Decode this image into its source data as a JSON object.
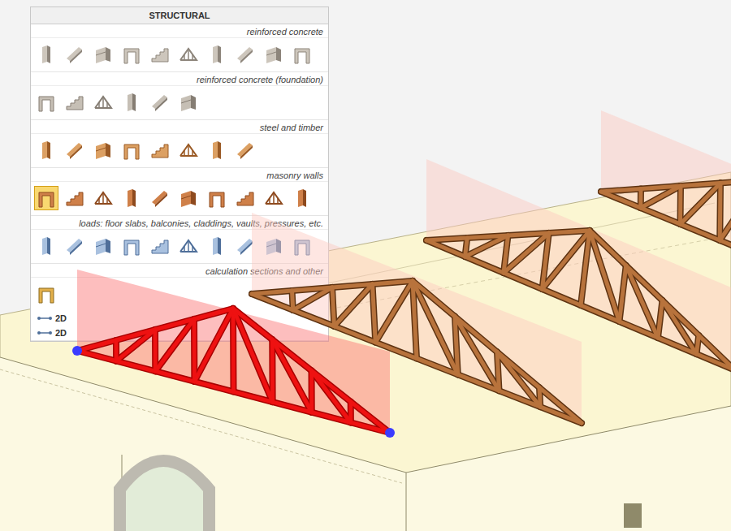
{
  "panel": {
    "title": "STRUCTURAL",
    "sections": [
      {
        "title": "reinforced concrete",
        "icons": [
          {
            "selected": false
          },
          {
            "selected": false
          },
          {
            "selected": false
          },
          {
            "selected": false
          },
          {
            "selected": false
          },
          {
            "selected": false
          },
          {
            "selected": false
          },
          {
            "selected": false
          },
          {
            "selected": false
          },
          {
            "selected": false
          }
        ]
      },
      {
        "title": "reinforced concrete (foundation)",
        "icons": [
          {
            "selected": false
          },
          {
            "selected": false
          },
          {
            "selected": false
          },
          {
            "selected": false
          },
          {
            "selected": false
          },
          {
            "selected": false
          }
        ]
      },
      {
        "title": "steel and timber",
        "icons": [
          {
            "selected": false
          },
          {
            "selected": false
          },
          {
            "selected": false
          },
          {
            "selected": false
          },
          {
            "selected": false
          },
          {
            "selected": false
          },
          {
            "selected": false
          },
          {
            "selected": false
          }
        ]
      },
      {
        "title": "masonry walls",
        "icons": [
          {
            "selected": true
          },
          {
            "selected": false
          },
          {
            "selected": false
          },
          {
            "selected": false
          },
          {
            "selected": false
          },
          {
            "selected": false
          },
          {
            "selected": false
          },
          {
            "selected": false
          },
          {
            "selected": false
          },
          {
            "selected": false
          }
        ]
      },
      {
        "title": "loads: floor slabs, balconies, claddings, vaults, pressures, etc.",
        "icons": [
          {
            "selected": false
          },
          {
            "selected": false
          },
          {
            "selected": false
          },
          {
            "selected": false
          },
          {
            "selected": false
          },
          {
            "selected": false
          },
          {
            "selected": false
          },
          {
            "selected": false
          },
          {
            "selected": false
          },
          {
            "selected": false
          }
        ]
      },
      {
        "title": "calculation sections and other",
        "icons": [
          {
            "selected": false
          }
        ],
        "labels": [
          "2D",
          "2D"
        ]
      }
    ]
  },
  "trusses": [
    {
      "selected": true
    },
    {
      "selected": false
    },
    {
      "selected": false
    },
    {
      "selected": false
    }
  ]
}
